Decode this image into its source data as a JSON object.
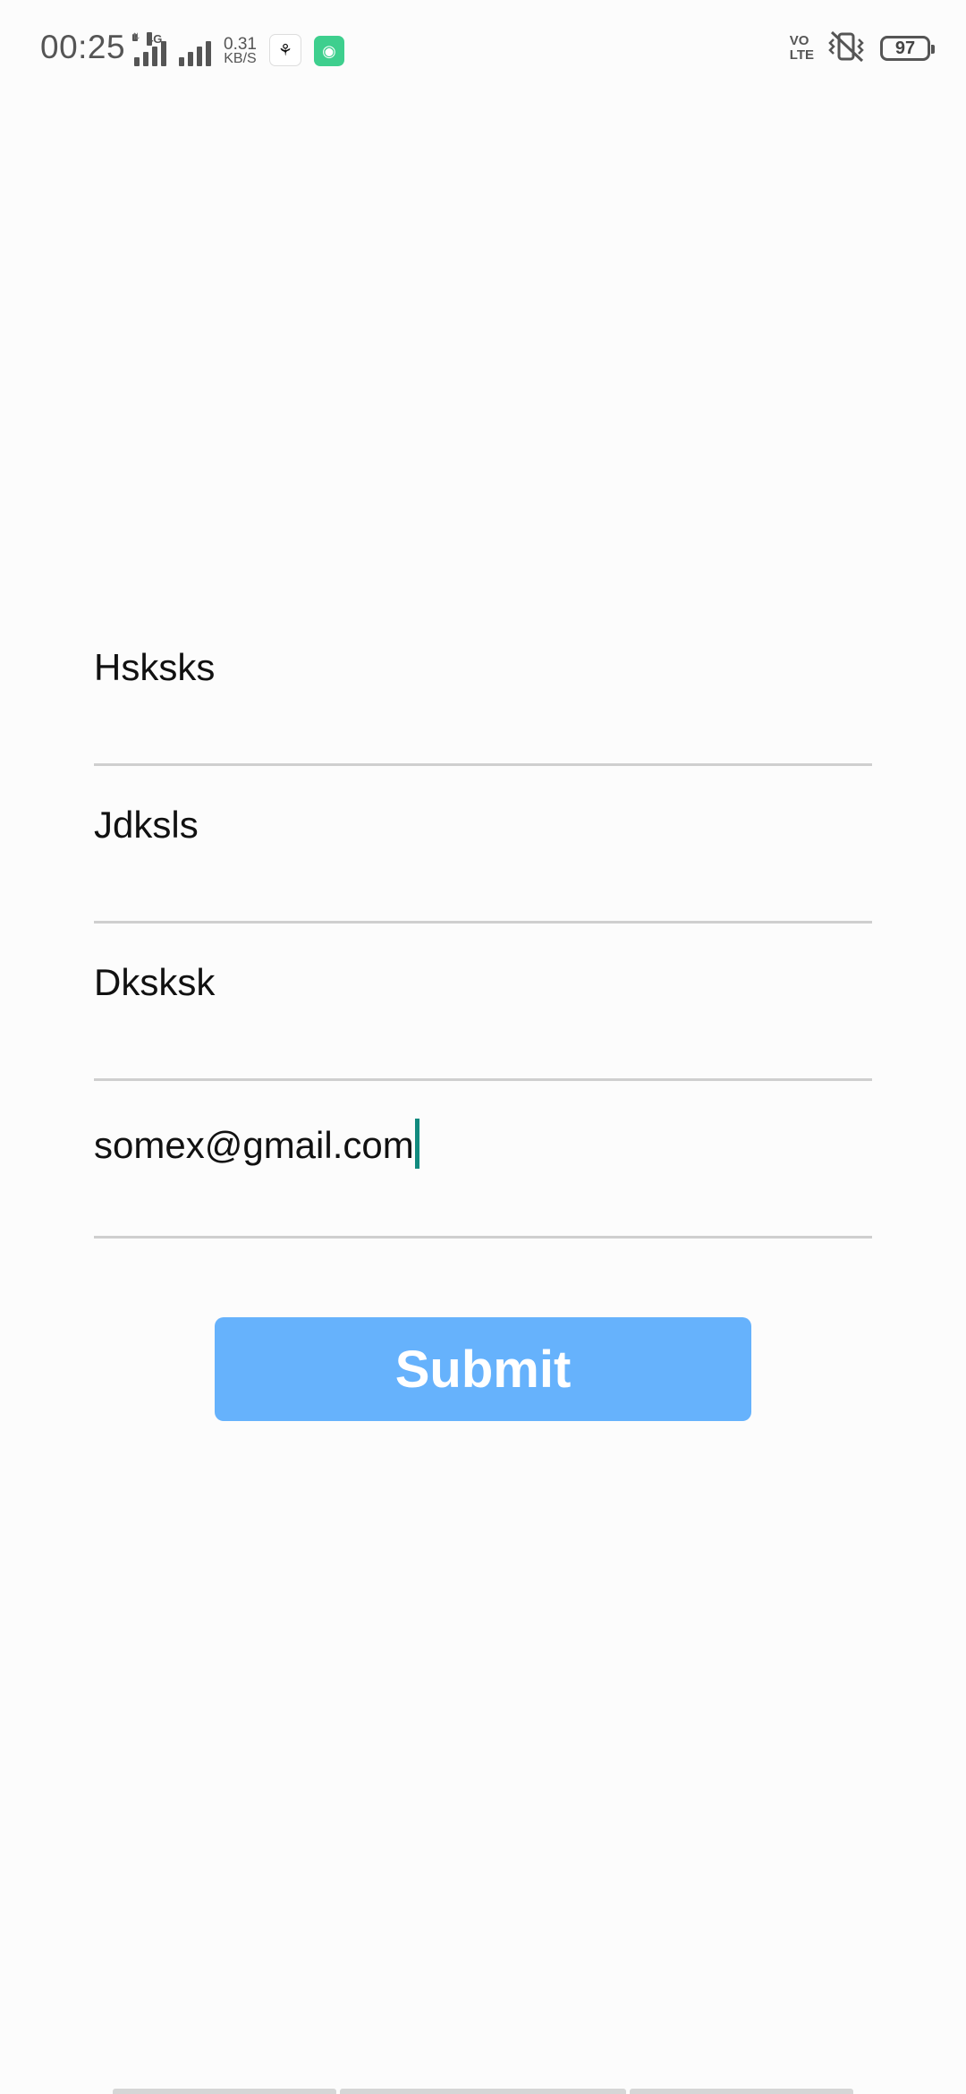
{
  "status_bar": {
    "time": "00:25",
    "network_type": "4G",
    "speed_value": "0.31",
    "speed_unit": "KB/S",
    "volte_line1": "VO",
    "volte_line2": "LTE",
    "battery_level": "97",
    "icons": [
      "signal-1-icon",
      "signal-2-icon",
      "app-notification-icon",
      "app-green-icon",
      "volte-icon",
      "vibrate-icon",
      "battery-icon"
    ]
  },
  "form": {
    "fields": [
      {
        "value": "Hsksks"
      },
      {
        "value": "Jdksls"
      },
      {
        "value": "Dksksk"
      },
      {
        "value": "somex@gmail.com"
      }
    ],
    "submit_label": "Submit"
  },
  "colors": {
    "button": "#66b2fc",
    "caret": "#118a7e",
    "divider": "#cfcfcf"
  }
}
